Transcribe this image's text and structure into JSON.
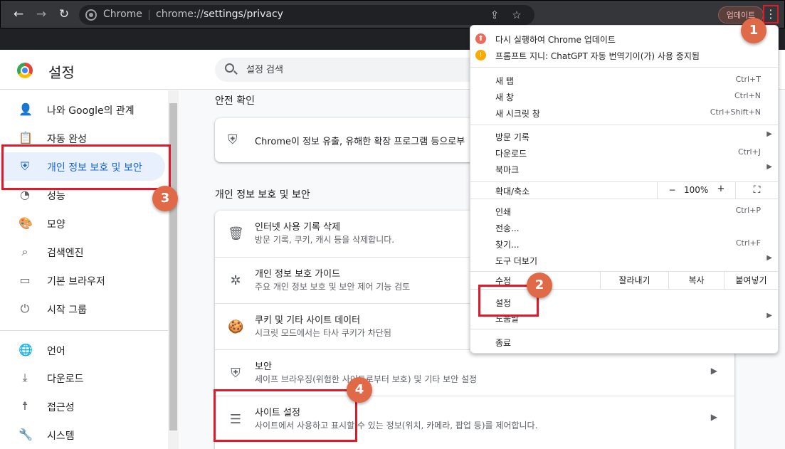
{
  "browser": {
    "chip_label": "Chrome",
    "url_scheme": "chrome://",
    "url_path": "settings/privacy",
    "update_label": "업데이트"
  },
  "header": {
    "title": "설정",
    "search_placeholder": "설정 검색"
  },
  "sidebar": {
    "items": [
      {
        "label": "나와 Google의 관계",
        "icon": "person-icon"
      },
      {
        "label": "자동 완성",
        "icon": "clipboard-icon"
      },
      {
        "label": "개인 정보 보호 및 보안",
        "icon": "shield-icon"
      },
      {
        "label": "성능",
        "icon": "speedometer-icon"
      },
      {
        "label": "모양",
        "icon": "palette-icon"
      },
      {
        "label": "검색엔진",
        "icon": "search-icon"
      },
      {
        "label": "기본 브라우저",
        "icon": "browser-icon"
      },
      {
        "label": "시작 그룹",
        "icon": "power-icon"
      },
      {
        "label": "언어",
        "icon": "globe-icon"
      },
      {
        "label": "다운로드",
        "icon": "download-icon"
      },
      {
        "label": "접근성",
        "icon": "accessibility-icon"
      },
      {
        "label": "시스템",
        "icon": "wrench-icon"
      }
    ]
  },
  "main": {
    "safety_title": "안전 확인",
    "safety_text": "Chrome이 정보 유출, 유해한 확장 프로그램 등으로부",
    "privacy_title": "개인 정보 보호 및 보안",
    "rows": [
      {
        "title": "인터넷 사용 기록 삭제",
        "desc": "방문 기록, 쿠키, 캐시 등을 삭제합니다.",
        "icon": "trash-icon"
      },
      {
        "title": "개인 정보 보호 가이드",
        "desc": "주요 개인 정보 보호 및 보안 제어 기능 검토",
        "icon": "compass-icon"
      },
      {
        "title": "쿠키 및 기타 사이트 데이터",
        "desc": "시크릿 모드에서는 타사 쿠키가 차단됨",
        "icon": "cookie-icon"
      },
      {
        "title": "보안",
        "desc": "세이프 브라우징(위험한 사이트로부터 보호) 및 기타 보안 설정",
        "icon": "shield-icon"
      },
      {
        "title": "사이트 설정",
        "desc": "사이트에서 사용하고 표시할 수 있는 정보(위치, 카메라, 팝업 등)를 제어합니다.",
        "icon": "tune-icon"
      }
    ]
  },
  "menu": {
    "notice1": "다시 실행하여 Chrome 업데이트",
    "notice2": "프롬프트 지니: ChatGPT 자동 번역기이(가) 사용 중지됨",
    "new_tab": "새 탭",
    "new_tab_sc": "Ctrl+T",
    "new_window": "새 창",
    "new_window_sc": "Ctrl+N",
    "incognito": "새 시크릿 창",
    "incognito_sc": "Ctrl+Shift+N",
    "history": "방문 기록",
    "downloads": "다운로드",
    "downloads_sc": "Ctrl+J",
    "bookmarks": "북마크",
    "zoom_label": "확대/축소",
    "zoom_minus": "−",
    "zoom_value": "100%",
    "zoom_plus": "+",
    "print": "인쇄",
    "print_sc": "Ctrl+P",
    "cast": "전송...",
    "find": "찾기...",
    "find_sc": "Ctrl+F",
    "more_tools": "도구 더보기",
    "edit": "수정",
    "cut": "잘라내기",
    "copy": "복사",
    "paste": "붙여넣기",
    "settings": "설정",
    "help": "도움말",
    "exit": "종료"
  },
  "annotations": {
    "b1": "1",
    "b2": "2",
    "b3": "3",
    "b4": "4"
  },
  "colors": {
    "accent": "#1967d2",
    "highlight": "#e8f0fe",
    "annotation_red": "#e0192b",
    "badge": "#e06a47"
  }
}
